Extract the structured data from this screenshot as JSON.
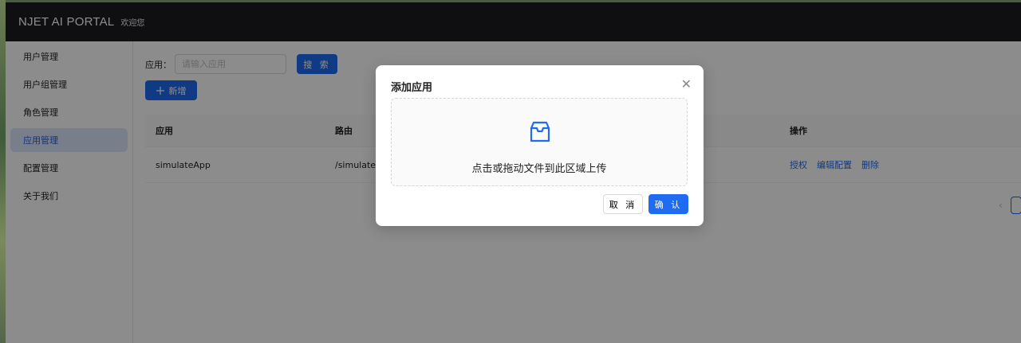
{
  "header": {
    "brand": "NJET AI PORTAL",
    "welcome": "欢迎您"
  },
  "sidebar": {
    "items": [
      {
        "label": "用户管理"
      },
      {
        "label": "用户组管理"
      },
      {
        "label": "角色管理"
      },
      {
        "label": "应用管理",
        "active": true
      },
      {
        "label": "配置管理"
      },
      {
        "label": "关于我们"
      }
    ]
  },
  "search": {
    "label": "应用：",
    "placeholder": "请输入应用",
    "button": "搜 索"
  },
  "add_button": {
    "label": "新增",
    "icon": "plus-icon"
  },
  "table": {
    "columns": [
      "应用",
      "路由",
      "操作"
    ],
    "rows": [
      {
        "app": "simulateApp",
        "route": "/simulate-",
        "actions": [
          "授权",
          "编辑配置",
          "删除"
        ]
      }
    ]
  },
  "modal": {
    "title": "添加应用",
    "upload_text": "点击或拖动文件到此区域上传",
    "upload_icon": "inbox-icon",
    "cancel": "取 消",
    "ok": "确 认"
  },
  "colors": {
    "primary": "#1f6bf2",
    "header_bg": "#1c1d21",
    "active_menu_bg": "#dbe6fb"
  }
}
